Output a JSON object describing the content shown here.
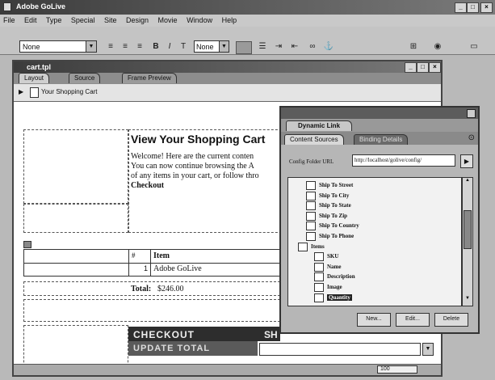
{
  "app": {
    "title": "Adobe GoLive",
    "window_controls": [
      "_",
      "□",
      "×"
    ]
  },
  "menu": [
    "File",
    "Edit",
    "Type",
    "Special",
    "Site",
    "Design",
    "Movie",
    "Window",
    "Help"
  ],
  "toolbar": {
    "font_value": "None",
    "size_value": "None",
    "icons": [
      "align-left-icon",
      "align-center-icon",
      "align-right-icon",
      "bold-icon",
      "italic-icon",
      "teletype-icon",
      "list-icon",
      "indent-icon",
      "outdent-icon",
      "link-icon",
      "anchor-icon",
      "site-icon",
      "go-icon",
      "preview-icon"
    ]
  },
  "doc": {
    "title": "cart.tpl",
    "tabs": [
      "Layout",
      "Source",
      "Frame Preview"
    ],
    "page_title": "Your Shopping Cart",
    "heading": "View Your Shopping Cart",
    "body_lines": [
      "Welcome! Here are the current conten",
      "You can now continue browsing the A",
      "of any items in your cart, or follow thro"
    ],
    "checkout_word": "Checkout",
    "table_head_num": "#",
    "table_head_item": "Item",
    "table_row_num": "1",
    "table_row_item": "Adobe GoLive",
    "total_label": "Total:",
    "total_value": "$246.00",
    "checkout_button": "CHECKOUT",
    "checkout_button_2": "SH",
    "update_button": "UPDATE TOTAL",
    "zoom": "100"
  },
  "palette": {
    "title": "Dynamic Link",
    "tabs": [
      "Content Sources",
      "Binding Details"
    ],
    "config_label": "Config Folder URL",
    "config_value": "http://localhost/golive/config/",
    "tree": [
      {
        "label": "Ship To Street",
        "indent": 1
      },
      {
        "label": "Ship To City",
        "indent": 1
      },
      {
        "label": "Ship To State",
        "indent": 1
      },
      {
        "label": "Ship To Zip",
        "indent": 1
      },
      {
        "label": "Ship To Country",
        "indent": 1
      },
      {
        "label": "Ship To Phone",
        "indent": 1
      },
      {
        "label": "Items",
        "indent": 0
      },
      {
        "label": "SKU",
        "indent": 2
      },
      {
        "label": "Name",
        "indent": 2
      },
      {
        "label": "Description",
        "indent": 2
      },
      {
        "label": "Image",
        "indent": 2
      },
      {
        "label": "Quantity",
        "indent": 2
      }
    ],
    "buttons": [
      "New...",
      "Edit...",
      "Delete"
    ]
  }
}
